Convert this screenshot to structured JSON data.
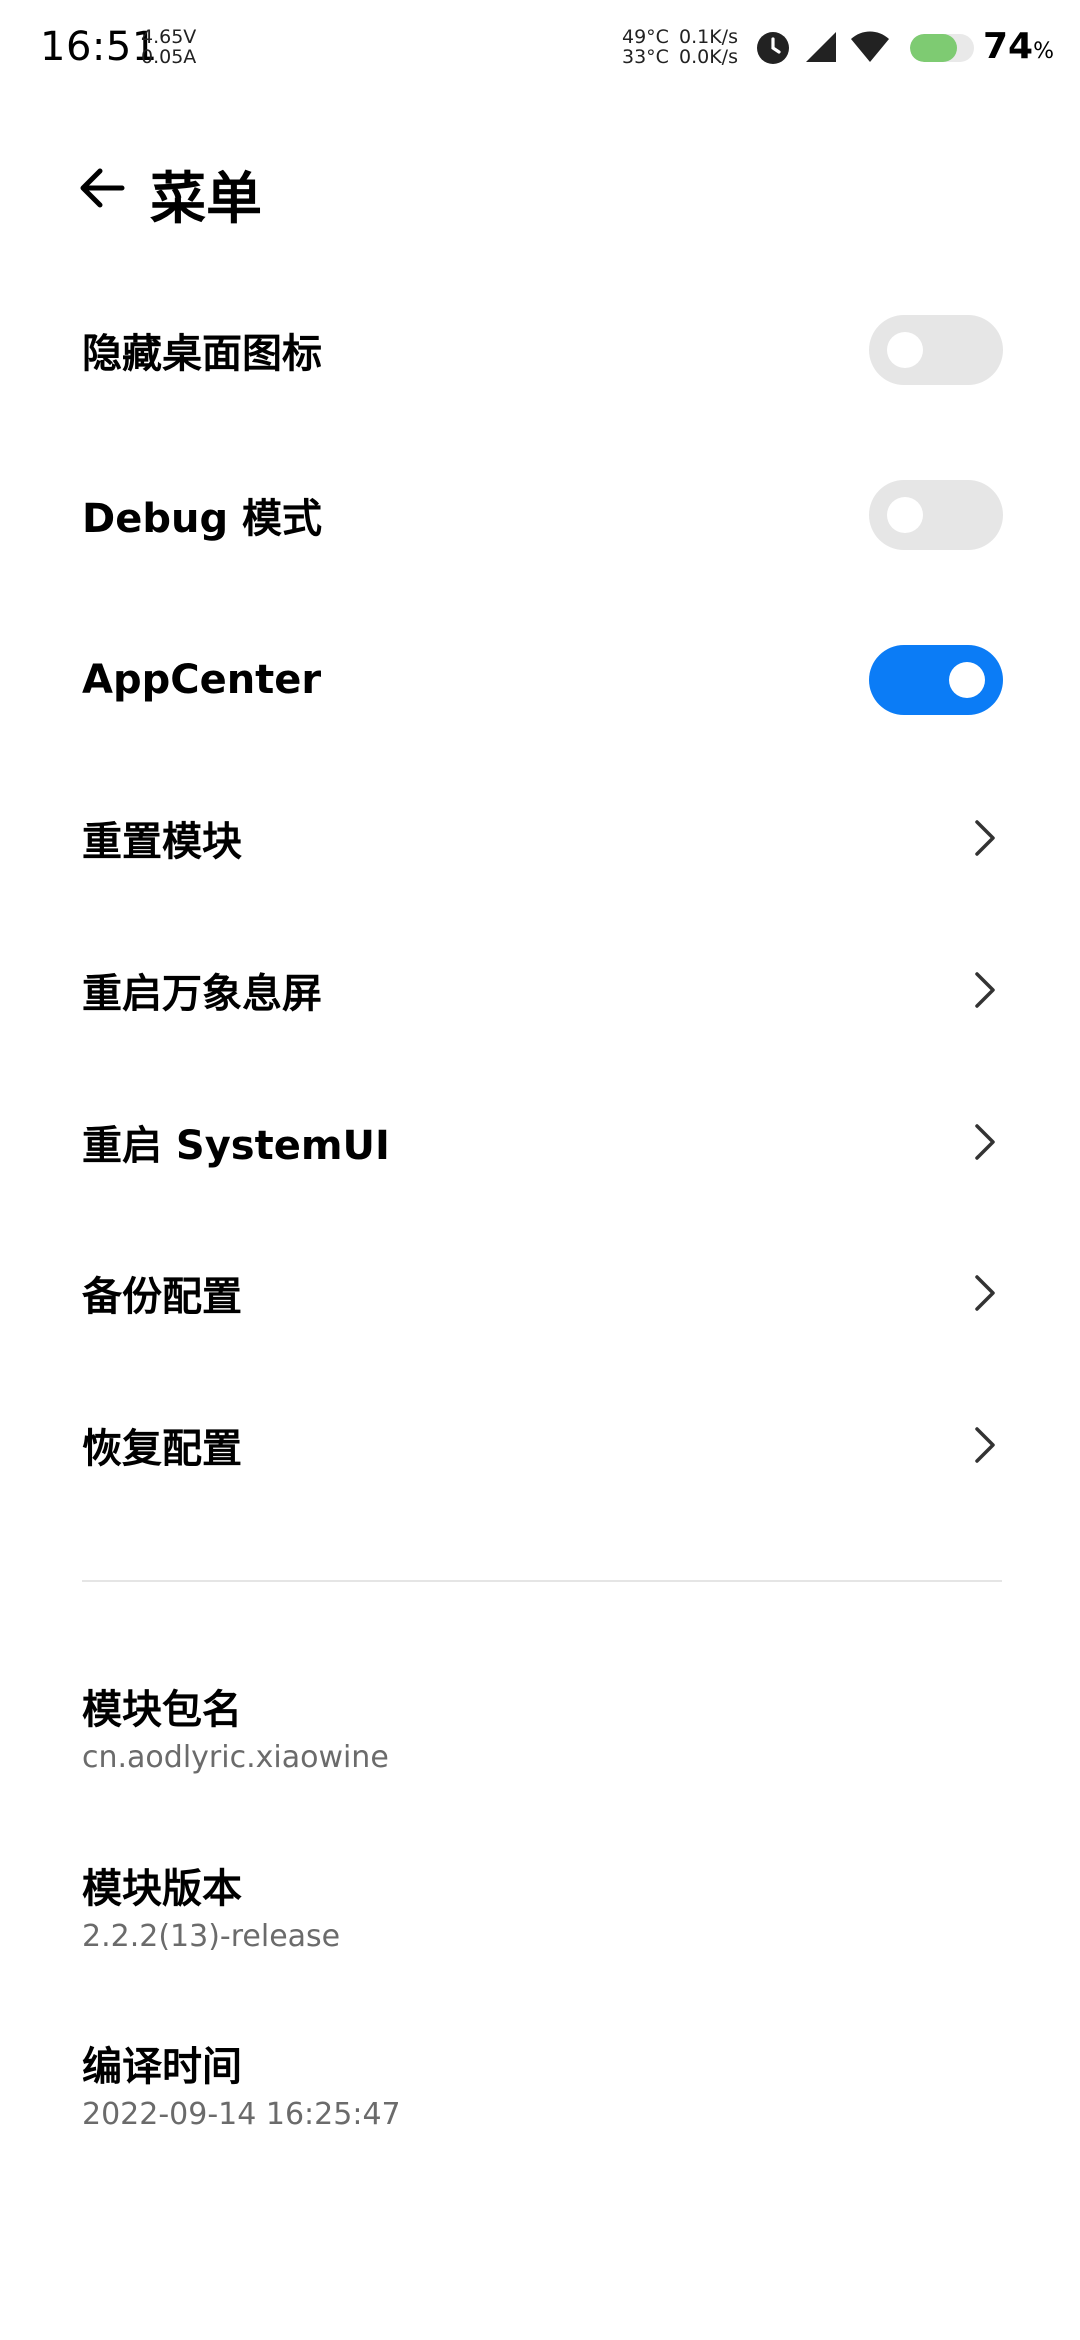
{
  "status_bar": {
    "time": "16:51",
    "voltage": "4.65V",
    "current": "0.05A",
    "temp1": "49°C",
    "temp2": "33°C",
    "speed_up": "0.1K/s",
    "speed_down": "0.0K/s",
    "battery_percent": "74",
    "battery_unit": "%",
    "battery_level": 0.74,
    "battery_color": "#7ecb72",
    "icons": [
      "alarm-icon",
      "cell-signal-icon",
      "wifi-icon",
      "battery-icon"
    ]
  },
  "header": {
    "title": "菜单",
    "back_icon": "back-arrow-icon"
  },
  "settings": {
    "hide_icon": {
      "label": "隐藏桌面图标",
      "state": "off"
    },
    "debug_mode": {
      "label": "Debug 模式",
      "state": "off"
    },
    "app_center": {
      "label": "AppCenter",
      "state": "on"
    },
    "reset_module": {
      "label": "重置模块"
    },
    "restart_aod": {
      "label": "重启万象息屏"
    },
    "restart_systemui": {
      "label": "重启 SystemUI"
    },
    "backup_config": {
      "label": "备份配置"
    },
    "restore_config": {
      "label": "恢复配置"
    }
  },
  "info": {
    "package": {
      "title": "模块包名",
      "value": "cn.aodlyric.xiaowine"
    },
    "version": {
      "title": "模块版本",
      "value": "2.2.2(13)-release"
    },
    "build_time": {
      "title": "编译时间",
      "value": "2022-09-14 16:25:47"
    }
  },
  "colors": {
    "accent": "#0b7cf6",
    "toggle_off": "#e6e6e6",
    "secondary_text": "#6b6b6b"
  }
}
